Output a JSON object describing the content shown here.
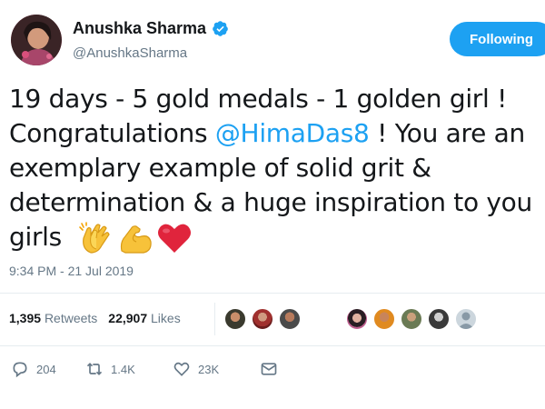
{
  "author": {
    "name": "Anushka Sharma",
    "handle": "@AnushkaSharma"
  },
  "follow_button": {
    "label": "Following"
  },
  "tweet": {
    "line1": "19 days - 5 gold medals - 1 golden girl !",
    "line2_prefix": "Congratulations ",
    "mention": "@HimaDas8",
    "line2_suffix": " ! You are an",
    "line3": "exemplary example of solid grit &",
    "line4": "determination & a huge inspiration to you",
    "line5": "girls"
  },
  "timestamp": "9:34 PM - 21 Jul 2019",
  "stats": {
    "retweets_count": "1,395",
    "retweets_label": "Retweets",
    "likes_count": "22,907",
    "likes_label": "Likes"
  },
  "actions": {
    "reply_count": "204",
    "retweet_count": "1.4K",
    "like_count": "23K"
  },
  "colors": {
    "accent": "#1da1f2",
    "muted": "#657786",
    "text": "#14171a"
  },
  "icons": [
    "verified-icon",
    "clap-emoji-icon",
    "flexed-biceps-emoji-icon",
    "red-heart-emoji-icon",
    "reply-icon",
    "retweet-icon",
    "like-icon",
    "direct-message-icon"
  ]
}
